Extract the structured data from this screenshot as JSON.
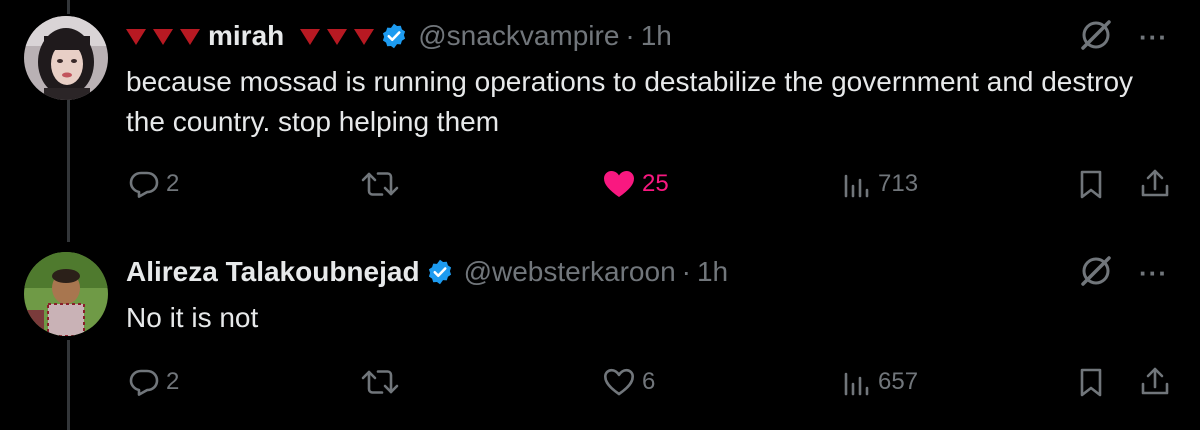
{
  "tweets": [
    {
      "name": "mirah",
      "handle": "@snackvampire",
      "dot": "·",
      "time": "1h",
      "text": "because mossad is running operations to destabilize the government and destroy the country. stop helping them",
      "replies": "2",
      "likes": "25",
      "liked": true,
      "views": "713",
      "more": "···"
    },
    {
      "name": "Alireza Talakoubnejad",
      "handle": "@websterkaroon",
      "dot": "·",
      "time": "1h",
      "text": "No it is not",
      "replies": "2",
      "likes": "6",
      "liked": false,
      "views": "657",
      "more": "···"
    }
  ],
  "colors": {
    "accent_like": "#f91880",
    "verified": "#1d9bf0",
    "triangle": "#f4212e",
    "muted": "#71767b"
  }
}
